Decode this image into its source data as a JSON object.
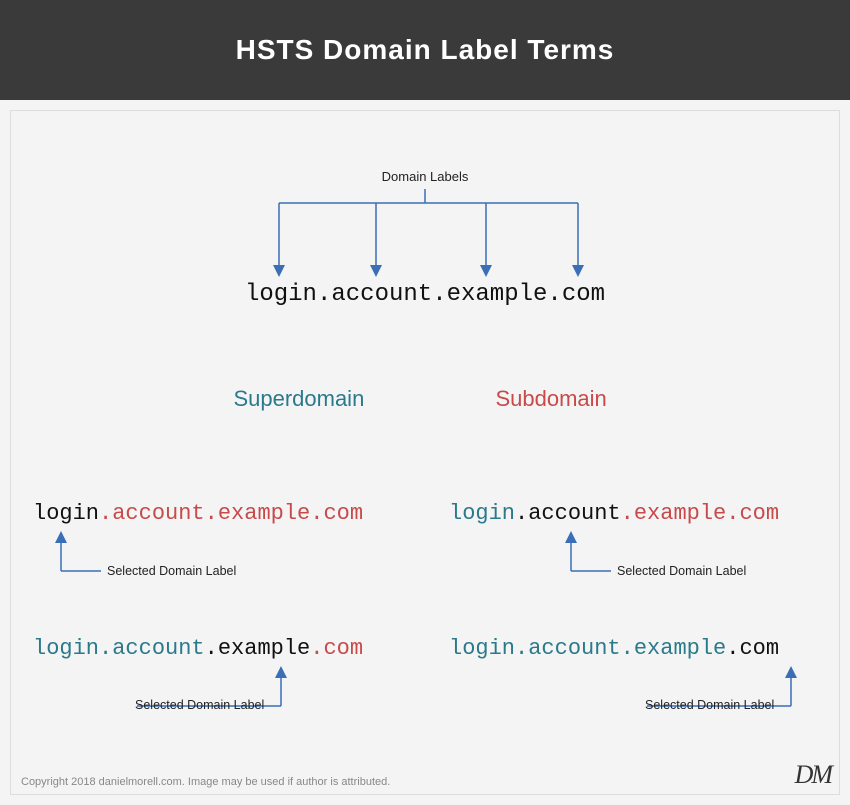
{
  "title": "HSTS Domain Label Terms",
  "domain_labels_caption": "Domain Labels",
  "main_domain": {
    "part1": "login",
    "part2": "account",
    "part3": "example",
    "part4": "com"
  },
  "section_superdomain": "Superdomain",
  "section_subdomain": "Subdomain",
  "selected_label_text": "Selected Domain Label",
  "examples": {
    "super_row1": {
      "login": "login",
      "account": "account",
      "example": "example",
      "com": "com"
    },
    "super_row2": {
      "login": "login",
      "account": "account",
      "example": "example",
      "com": "com"
    },
    "sub_row1": {
      "login": "login",
      "account": "account",
      "example": "example",
      "com": "com"
    },
    "sub_row2": {
      "login": "login",
      "account": "account",
      "example": "example",
      "com": "com"
    }
  },
  "footer": "Copyright 2018 danielmorell.com. Image may be used if author is attributed.",
  "logo": "DM",
  "colors": {
    "teal": "#2a7a8c",
    "red": "#c84a4a",
    "arrow": "#3a6fb7"
  }
}
